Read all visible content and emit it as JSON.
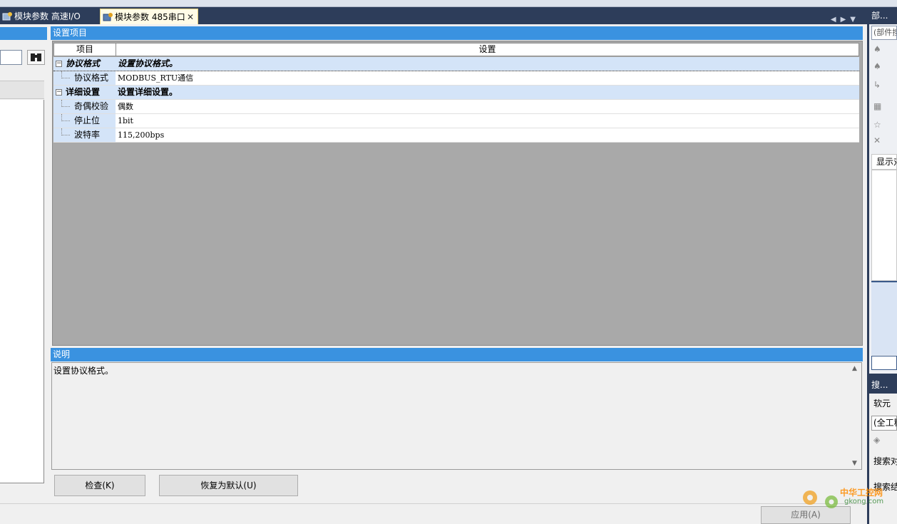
{
  "tabs": [
    {
      "label": "模块参数 高速I/O",
      "active": false
    },
    {
      "label": "模块参数 485串口",
      "active": true
    }
  ],
  "settings": {
    "title": "设置项目",
    "columns": [
      "项目",
      "设置"
    ],
    "rows": [
      {
        "type": "group",
        "label": "协议格式",
        "value": "设置协议格式。"
      },
      {
        "type": "item",
        "label": "协议格式",
        "value": "MODBUS_RTU通信"
      },
      {
        "type": "group",
        "label": "详细设置",
        "value": "设置详细设置。"
      },
      {
        "type": "item",
        "label": "奇偶校验",
        "value": "偶数"
      },
      {
        "type": "item",
        "label": "停止位",
        "value": "1bit"
      },
      {
        "type": "item",
        "label": "波特率",
        "value": "115,200bps"
      }
    ]
  },
  "description": {
    "title": "说明",
    "text": "设置协议格式。"
  },
  "buttons": {
    "check": "检查(K)",
    "reset": "恢复为默认(U)",
    "apply": "应用(A)"
  },
  "right_panel": {
    "parts_title": "部...",
    "parts_search_placeholder": "(部件搜",
    "display_tab": "显示对",
    "search_title": "搜...",
    "software_label": "软元",
    "scope_value": "(全工程",
    "search_target_label": "搜索对",
    "search_label": "搜索结"
  },
  "watermark": {
    "text": "中华工控网",
    "url": "gkong.com"
  },
  "colors": {
    "header_blue": "#3a92e0",
    "dark_frame": "#2d3d5a",
    "group_row": "#d4e4f8"
  }
}
